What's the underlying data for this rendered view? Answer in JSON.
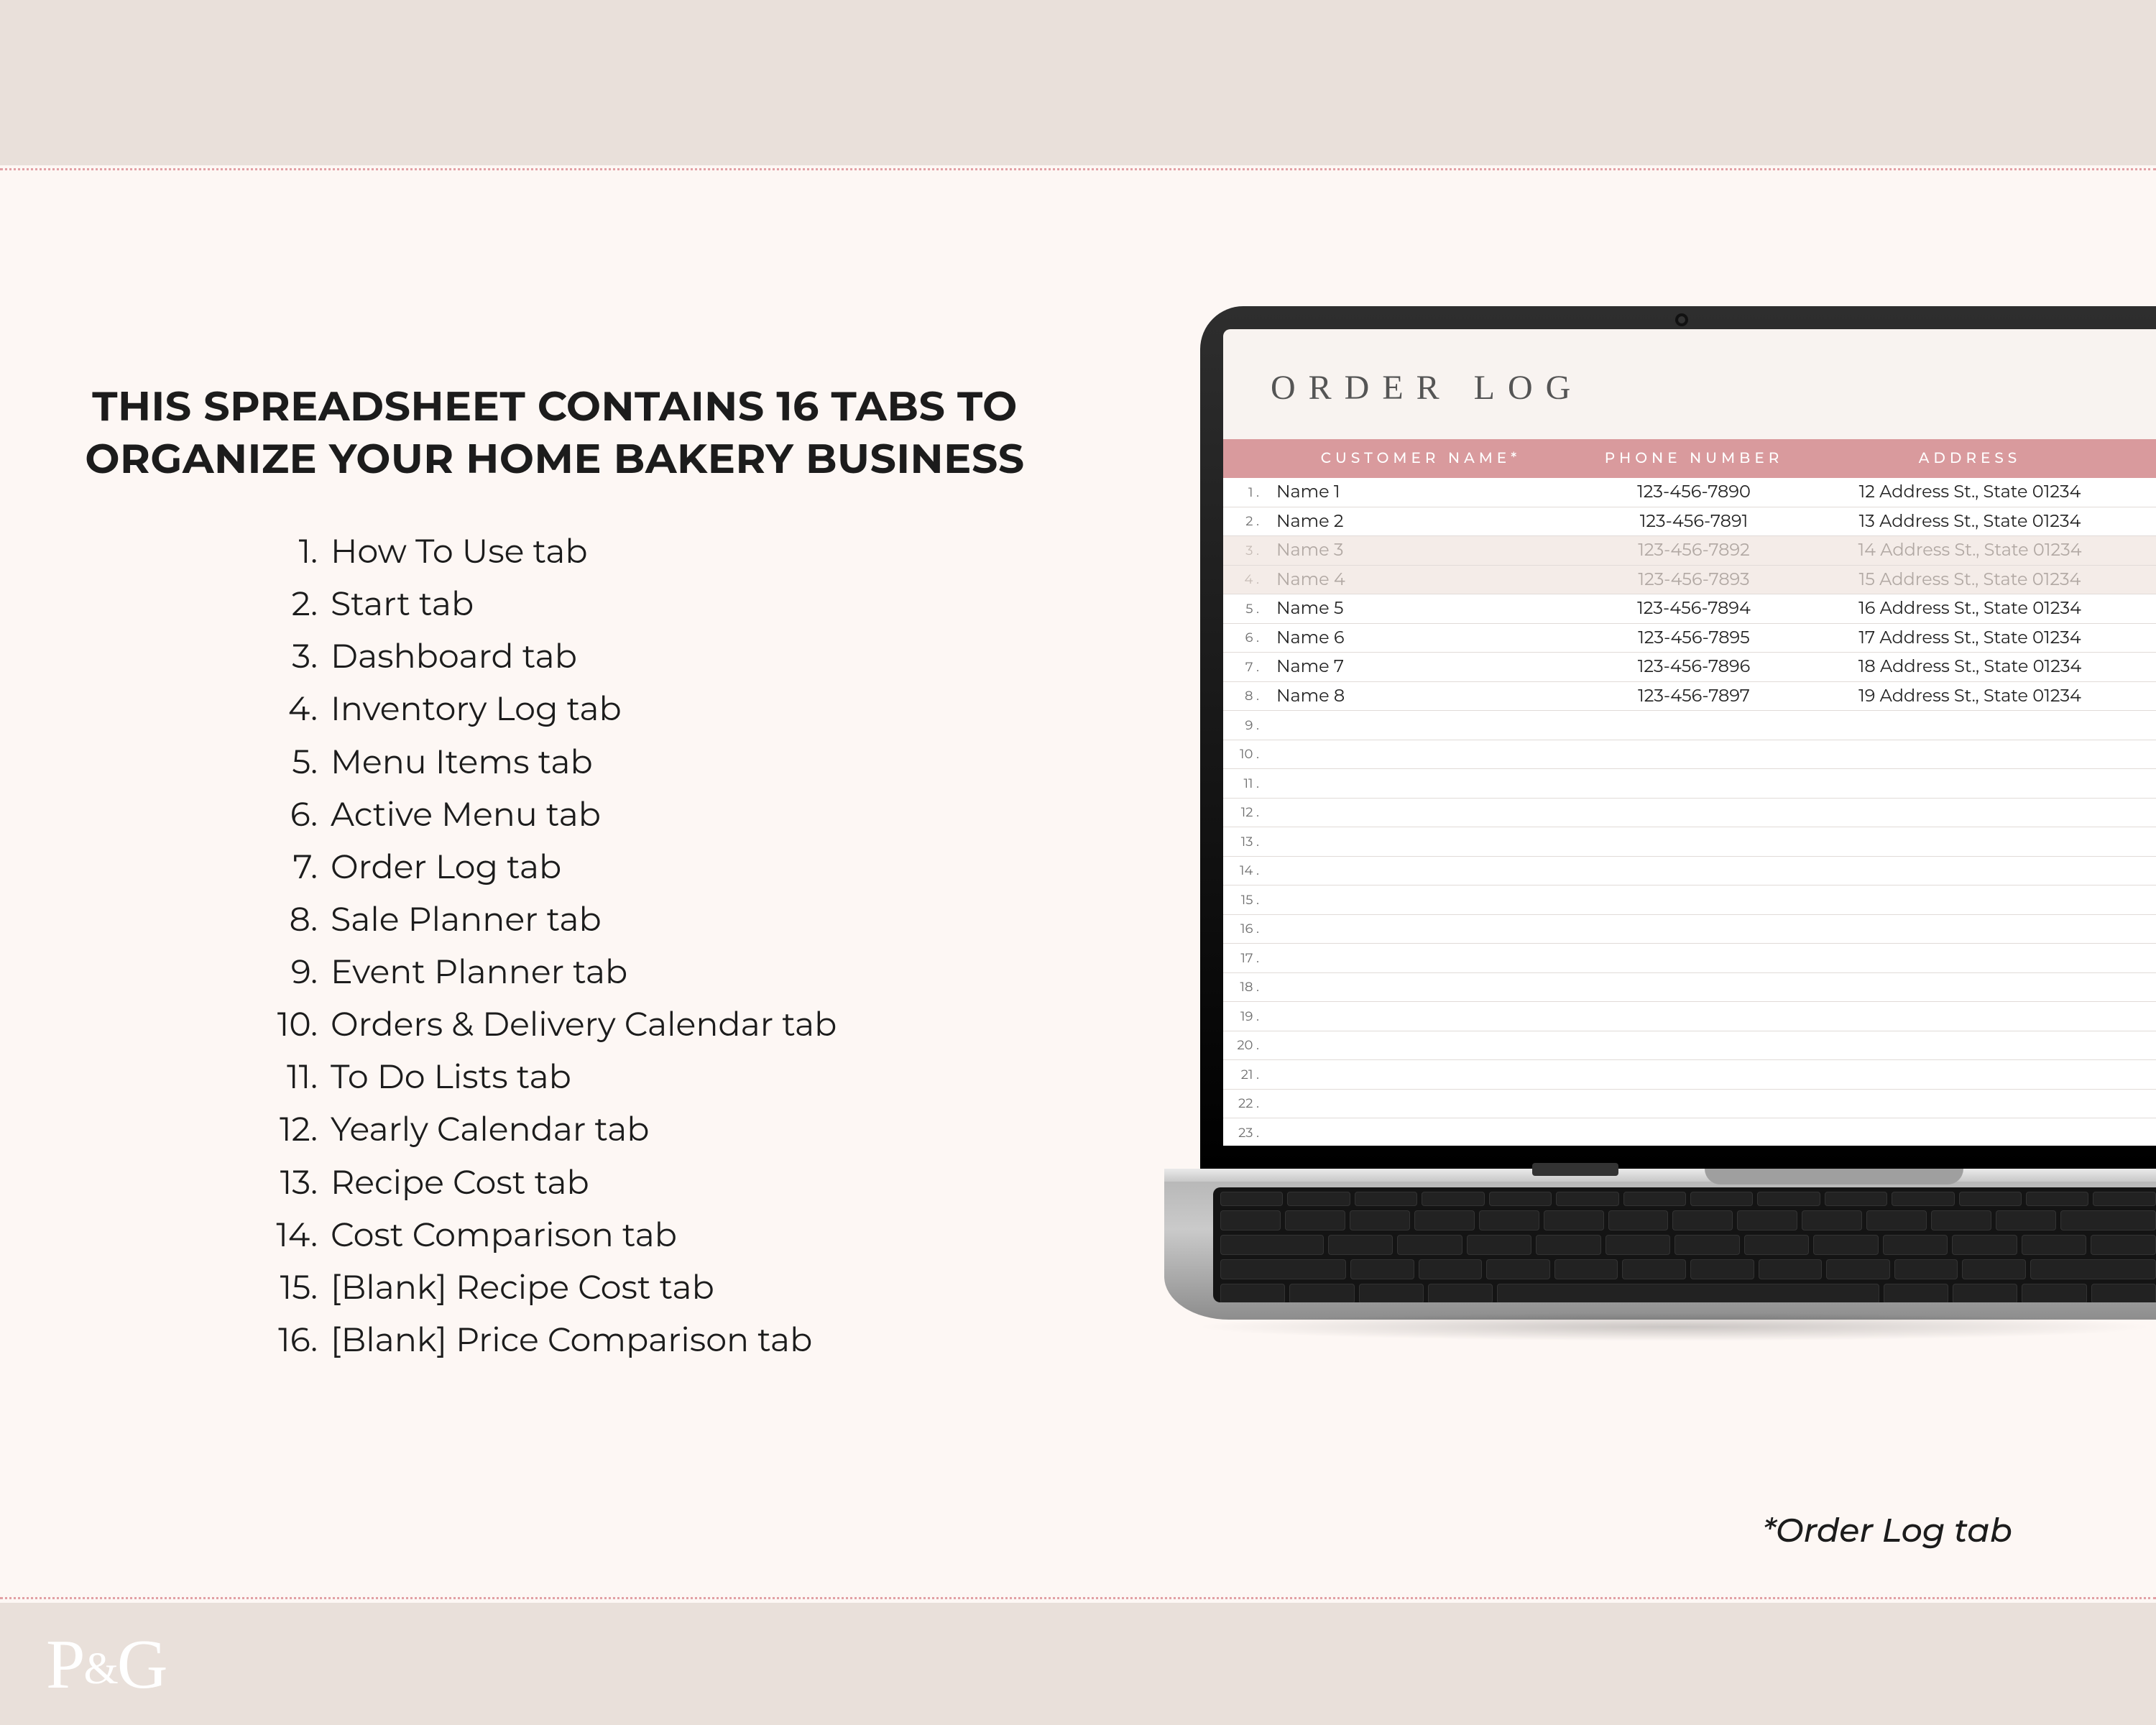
{
  "headline": "THIS SPREADSHEET CONTAINS 16 TABS TO ORGANIZE YOUR HOME BAKERY BUSINESS",
  "tabs": [
    "How To Use tab",
    "Start tab",
    "Dashboard tab",
    "Inventory Log tab",
    "Menu Items tab",
    "Active Menu tab",
    "Order Log tab",
    "Sale Planner tab",
    "Event Planner tab",
    "Orders & Delivery Calendar tab",
    "To Do Lists tab",
    "Yearly Calendar tab",
    "Recipe Cost tab",
    "Cost Comparison tab",
    "[Blank] Recipe Cost tab",
    "[Blank] Price Comparison tab"
  ],
  "sheet": {
    "title": "ORDER LOG",
    "columns": {
      "name": "CUSTOMER NAME*",
      "phone": "PHONE NUMBER",
      "address": "ADDRESS"
    },
    "rows": [
      {
        "n": "1",
        "name": "Name 1",
        "phone": "123-456-7890",
        "address": "12 Address St., State 01234",
        "completed": false
      },
      {
        "n": "2",
        "name": "Name 2",
        "phone": "123-456-7891",
        "address": "13 Address St., State 01234",
        "completed": false
      },
      {
        "n": "3",
        "name": "Name 3",
        "phone": "123-456-7892",
        "address": "14 Address St., State 01234",
        "completed": true
      },
      {
        "n": "4",
        "name": "Name 4",
        "phone": "123-456-7893",
        "address": "15 Address St., State 01234",
        "completed": true
      },
      {
        "n": "5",
        "name": "Name 5",
        "phone": "123-456-7894",
        "address": "16 Address St., State 01234",
        "completed": false
      },
      {
        "n": "6",
        "name": "Name 6",
        "phone": "123-456-7895",
        "address": "17 Address St., State 01234",
        "completed": false
      },
      {
        "n": "7",
        "name": "Name 7",
        "phone": "123-456-7896",
        "address": "18 Address St., State 01234",
        "completed": false
      },
      {
        "n": "8",
        "name": "Name 8",
        "phone": "123-456-7897",
        "address": "19 Address St., State 01234",
        "completed": false
      },
      {
        "n": "9",
        "name": "",
        "phone": "",
        "address": "",
        "completed": false
      },
      {
        "n": "10",
        "name": "",
        "phone": "",
        "address": "",
        "completed": false
      },
      {
        "n": "11",
        "name": "",
        "phone": "",
        "address": "",
        "completed": false
      },
      {
        "n": "12",
        "name": "",
        "phone": "",
        "address": "",
        "completed": false
      },
      {
        "n": "13",
        "name": "",
        "phone": "",
        "address": "",
        "completed": false
      },
      {
        "n": "14",
        "name": "",
        "phone": "",
        "address": "",
        "completed": false
      },
      {
        "n": "15",
        "name": "",
        "phone": "",
        "address": "",
        "completed": false
      },
      {
        "n": "16",
        "name": "",
        "phone": "",
        "address": "",
        "completed": false
      },
      {
        "n": "17",
        "name": "",
        "phone": "",
        "address": "",
        "completed": false
      },
      {
        "n": "18",
        "name": "",
        "phone": "",
        "address": "",
        "completed": false
      },
      {
        "n": "19",
        "name": "",
        "phone": "",
        "address": "",
        "completed": false
      },
      {
        "n": "20",
        "name": "",
        "phone": "",
        "address": "",
        "completed": false
      },
      {
        "n": "21",
        "name": "",
        "phone": "",
        "address": "",
        "completed": false
      },
      {
        "n": "22",
        "name": "",
        "phone": "",
        "address": "",
        "completed": false
      },
      {
        "n": "23",
        "name": "",
        "phone": "",
        "address": "",
        "completed": false
      }
    ]
  },
  "caption": "*Order Log tab",
  "logo": {
    "left": "P",
    "amp": "&",
    "right": "G"
  },
  "colors": {
    "page_bg": "#fdf7f4",
    "band_bg": "#e9e0da",
    "accent_pink": "#d99a9d",
    "dotted": "#e2a0a5"
  }
}
